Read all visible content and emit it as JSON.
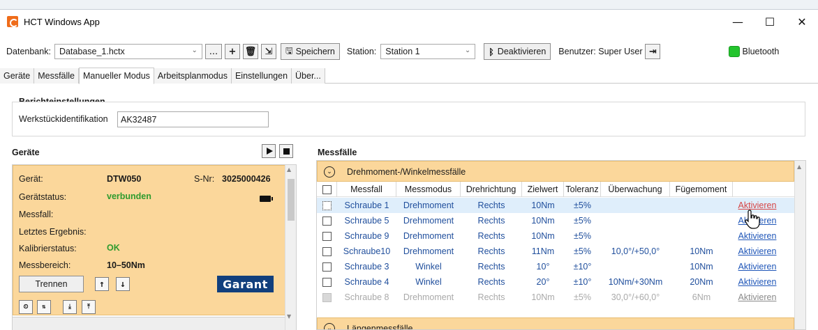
{
  "window": {
    "title": "HCT Windows App",
    "minimize": "—",
    "maximize": "☐",
    "close": "✕"
  },
  "toolbar": {
    "database_label": "Datenbank:",
    "database_value": "Database_1.hctx",
    "browse_label": "...",
    "save_label": "Speichern",
    "station_label": "Station:",
    "station_value": "Station 1",
    "deactivate_label": "Deaktivieren",
    "user_label": "Benutzer: Super User",
    "bluetooth_label": "Bluetooth",
    "bluetooth_status_color": "#23c42d"
  },
  "tabs": [
    {
      "label": "Geräte"
    },
    {
      "label": "Messfälle"
    },
    {
      "label": "Manueller Modus",
      "active": true
    },
    {
      "label": "Arbeitsplanmodus"
    },
    {
      "label": "Einstellungen"
    },
    {
      "label": "Über..."
    }
  ],
  "report": {
    "title": "Berichteinstellungen",
    "workpiece_label": "Werkstückidentifikation",
    "workpiece_value": "AK32487"
  },
  "devices": {
    "title": "Geräte",
    "card": {
      "device_label": "Gerät:",
      "device_value": "DTW050",
      "serial_label": "S-Nr:",
      "serial_value": "3025000426",
      "status_label": "Gerätstatus:",
      "status_value": "verbunden",
      "case_label": "Messfall:",
      "last_result_label": "Letztes Ergebnis:",
      "calibration_label": "Kalibrierstatus:",
      "calibration_value": "OK",
      "range_label": "Messbereich:",
      "range_value": "10–50Nm",
      "disconnect_label": "Trennen",
      "brand_label": "Garant"
    }
  },
  "measure_cases": {
    "title": "Messfälle",
    "group_title": "Drehmoment-/Winkelmessfälle",
    "group2_title": "Längenmessfälle",
    "columns": [
      "Messfall",
      "Messmodus",
      "Drehrichtung",
      "Zielwert",
      "Toleranz",
      "Überwachung",
      "Fügemoment"
    ],
    "rows": [
      {
        "name": "Schraube 1",
        "mode": "Drehmoment",
        "dir": "Rechts",
        "target": "10Nm",
        "tol": "±5%",
        "monitor": "",
        "joint": "",
        "action": "Aktivieren"
      },
      {
        "name": "Schraube 5",
        "mode": "Drehmoment",
        "dir": "Rechts",
        "target": "10Nm",
        "tol": "±5%",
        "monitor": "",
        "joint": "",
        "action": "Aktivieren"
      },
      {
        "name": "Schraube 9",
        "mode": "Drehmoment",
        "dir": "Rechts",
        "target": "10Nm",
        "tol": "±5%",
        "monitor": "",
        "joint": "",
        "action": "Aktivieren"
      },
      {
        "name": "Schraube10",
        "mode": "Drehmoment",
        "dir": "Rechts",
        "target": "11Nm",
        "tol": "±5%",
        "monitor": "10,0°/+50,0°",
        "joint": "10Nm",
        "action": "Aktivieren"
      },
      {
        "name": "Schraube 3",
        "mode": "Winkel",
        "dir": "Rechts",
        "target": "10°",
        "tol": "±10°",
        "monitor": "",
        "joint": "10Nm",
        "action": "Aktivieren"
      },
      {
        "name": "Schraube 4",
        "mode": "Winkel",
        "dir": "Rechts",
        "target": "20°",
        "tol": "±10°",
        "monitor": "10Nm/+30Nm",
        "joint": "20Nm",
        "action": "Aktivieren"
      },
      {
        "name": "Schraube 8",
        "mode": "Drehmoment",
        "dir": "Rechts",
        "target": "10Nm",
        "tol": "±5%",
        "monitor": "30,0°/+60,0°",
        "joint": "6Nm",
        "action": "Aktivieren"
      }
    ]
  }
}
